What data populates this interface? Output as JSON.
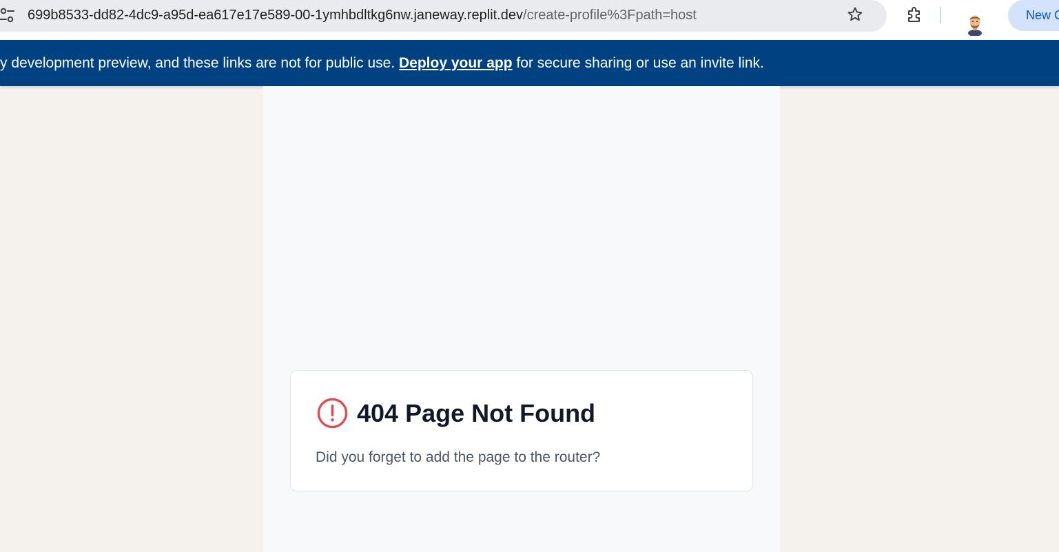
{
  "browser": {
    "url_host": "699b8533-dd82-4dc9-a95d-ea617e17e589-00-1ymhbdltkg6nw.janeway.replit.dev",
    "url_path": "/create-profile%3Fpath=host",
    "new_chip_label": "New C",
    "icons": [
      "site-info-icon",
      "bookmark-star-icon",
      "extensions-icon",
      "profile-avatar"
    ]
  },
  "banner": {
    "text_before": "y development preview, and these links are not for public use. ",
    "link_label": "Deploy your app",
    "text_after": " for secure sharing or use an invite link.",
    "background": "#004182"
  },
  "error_card": {
    "title": "404 Page Not Found",
    "message": "Did you forget to add the page to the router?",
    "icon": "alert-circle-icon",
    "icon_color": "#e5484d"
  }
}
